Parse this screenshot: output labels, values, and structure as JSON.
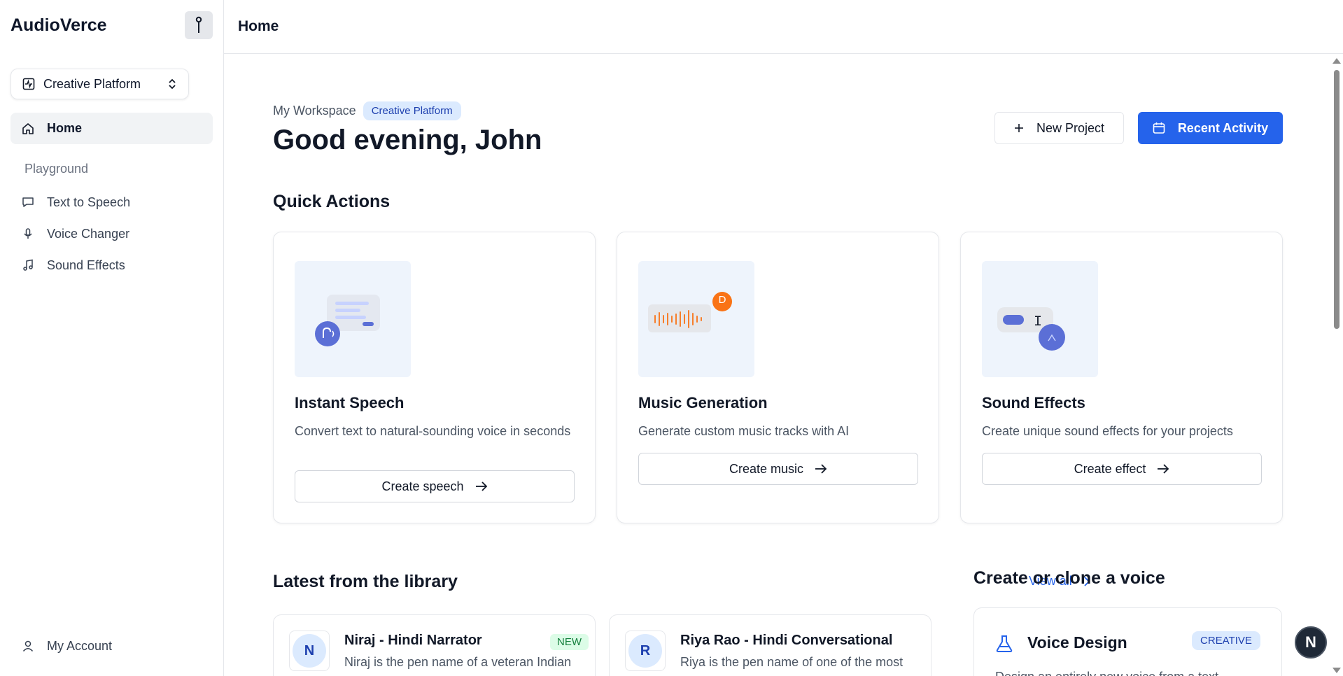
{
  "app": {
    "name": "AudioVerce"
  },
  "workspace_selector": {
    "label": "Creative Platform"
  },
  "sidebar": {
    "home": "Home",
    "section_label": "Playground",
    "items": [
      {
        "label": "Text to Speech",
        "icon": "message-square-icon"
      },
      {
        "label": "Voice Changer",
        "icon": "mic-icon"
      },
      {
        "label": "Sound Effects",
        "icon": "music-note-icon"
      }
    ],
    "account": "My Account"
  },
  "topbar": {
    "title": "Home"
  },
  "header": {
    "crumb": "My Workspace",
    "badge": "Creative Platform",
    "greeting": "Good evening, John",
    "new_project": "New Project",
    "recent_activity": "Recent Activity"
  },
  "quick_actions": {
    "heading": "Quick Actions",
    "cards": [
      {
        "title": "Instant Speech",
        "desc": "Convert text to natural-sounding voice in seconds",
        "cta": "Create speech"
      },
      {
        "title": "Music Generation",
        "desc": "Generate custom music tracks with AI",
        "cta": "Create music",
        "avatar_letter": "D"
      },
      {
        "title": "Sound Effects",
        "desc": "Create unique sound effects for your projects",
        "cta": "Create effect"
      }
    ]
  },
  "library": {
    "heading": "Latest from the library",
    "view_all": "View all",
    "items": [
      {
        "initial": "N",
        "name": "Niraj - Hindi Narrator",
        "badge": "NEW",
        "desc": "Niraj is the pen name of a veteran Indian"
      },
      {
        "initial": "R",
        "name": "Riya Rao - Hindi Conversational",
        "desc": "Riya is the pen name of one of the most"
      }
    ]
  },
  "clone": {
    "heading": "Create or clone a voice",
    "card": {
      "title": "Voice Design",
      "badge": "CREATIVE",
      "desc": "Design an entirely new voice from a text"
    }
  },
  "floating_button": {
    "letter": "N"
  },
  "colors": {
    "primary": "#2563eb",
    "accent_orange": "#f97316",
    "indigo": "#5b6fd6"
  }
}
